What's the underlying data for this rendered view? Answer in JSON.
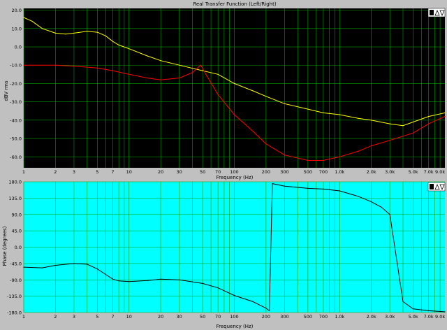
{
  "colors": {
    "top_background": "#000000",
    "bottom_background": "#00ffff",
    "panel_background": "#c0c0c0",
    "grid_top": "#00a000",
    "grid_bottom": "#00a000",
    "left_channel": "#ffff00",
    "right_channel": "#ff0000",
    "phase_trace": "#000000"
  },
  "chart_data": [
    {
      "type": "line",
      "title": "Real Transfer Function (Left/Right)",
      "xlabel": "Frequency (Hz)",
      "ylabel": "dBV rms",
      "x_scale": "log",
      "xlim": [
        1,
        10000
      ],
      "ylim": [
        -66,
        21
      ],
      "grid": true,
      "x_ticks": [
        {
          "value": 1,
          "label": "1"
        },
        {
          "value": 2,
          "label": "2"
        },
        {
          "value": 3,
          "label": "3"
        },
        {
          "value": 5,
          "label": "5"
        },
        {
          "value": 7,
          "label": "7"
        },
        {
          "value": 10,
          "label": "10"
        },
        {
          "value": 20,
          "label": "20"
        },
        {
          "value": 30,
          "label": "30"
        },
        {
          "value": 50,
          "label": "50"
        },
        {
          "value": 70,
          "label": "70"
        },
        {
          "value": 100,
          "label": "100"
        },
        {
          "value": 200,
          "label": "200"
        },
        {
          "value": 300,
          "label": "300"
        },
        {
          "value": 500,
          "label": "500"
        },
        {
          "value": 700,
          "label": "700"
        },
        {
          "value": 1000,
          "label": "1.0k"
        },
        {
          "value": 2000,
          "label": "2.0k"
        },
        {
          "value": 3000,
          "label": "3.0k"
        },
        {
          "value": 5000,
          "label": "5.0k"
        },
        {
          "value": 7000,
          "label": "7.0k"
        },
        {
          "value": 9000,
          "label": "9.0k"
        }
      ],
      "y_ticks": [
        {
          "value": 20,
          "label": "20.0"
        },
        {
          "value": 10,
          "label": "10.0"
        },
        {
          "value": 0,
          "label": "0.0"
        },
        {
          "value": -10,
          "label": "-10.0"
        },
        {
          "value": -20,
          "label": "-20.0"
        },
        {
          "value": -30,
          "label": "-30.0"
        },
        {
          "value": -40,
          "label": "-40.0"
        },
        {
          "value": -50,
          "label": "-50.0"
        },
        {
          "value": -60,
          "label": "-60.0"
        }
      ],
      "series": [
        {
          "color": "#ffff00",
          "x": [
            1,
            1.2,
            1.5,
            2,
            2.5,
            3,
            4,
            5,
            6,
            7,
            8,
            10,
            15,
            20,
            30,
            50,
            70,
            100,
            150,
            200,
            300,
            500,
            700,
            1000,
            1500,
            2000,
            3000,
            4000,
            5000,
            7000,
            10000
          ],
          "y": [
            16,
            14,
            10,
            7.5,
            7,
            7.5,
            8.5,
            8,
            6,
            3,
            1,
            -1,
            -5,
            -7.5,
            -10,
            -13,
            -15,
            -20,
            -24,
            -27,
            -31,
            -34,
            -36,
            -37,
            -39,
            -40,
            -42,
            -43,
            -41,
            -38,
            -36
          ]
        },
        {
          "color": "#ff0000",
          "x": [
            1,
            2,
            3,
            5,
            7,
            10,
            15,
            20,
            30,
            40,
            48,
            55,
            70,
            100,
            150,
            200,
            300,
            500,
            700,
            1000,
            1500,
            2000,
            3000,
            5000,
            7000,
            10000
          ],
          "y": [
            -10,
            -10,
            -10.5,
            -11.5,
            -13,
            -15,
            -17,
            -18,
            -17,
            -14,
            -10,
            -16,
            -26,
            -37,
            -46,
            -53,
            -59,
            -62,
            -62,
            -60,
            -57,
            -54,
            -51,
            -47,
            -42,
            -38
          ]
        }
      ]
    },
    {
      "type": "line",
      "title": "",
      "xlabel": "Frequency (Hz)",
      "ylabel": "Phase (degrees)",
      "x_scale": "log",
      "xlim": [
        1,
        10000
      ],
      "ylim": [
        -180,
        180
      ],
      "grid": true,
      "x_ticks": [
        {
          "value": 1,
          "label": "1"
        },
        {
          "value": 2,
          "label": "2"
        },
        {
          "value": 3,
          "label": "3"
        },
        {
          "value": 5,
          "label": "5"
        },
        {
          "value": 7,
          "label": "7"
        },
        {
          "value": 10,
          "label": "10"
        },
        {
          "value": 20,
          "label": "20"
        },
        {
          "value": 30,
          "label": "30"
        },
        {
          "value": 50,
          "label": "50"
        },
        {
          "value": 70,
          "label": "70"
        },
        {
          "value": 100,
          "label": "100"
        },
        {
          "value": 200,
          "label": "200"
        },
        {
          "value": 300,
          "label": "300"
        },
        {
          "value": 500,
          "label": "500"
        },
        {
          "value": 700,
          "label": "700"
        },
        {
          "value": 1000,
          "label": "1.0k"
        },
        {
          "value": 2000,
          "label": "2.0k"
        },
        {
          "value": 3000,
          "label": "3.0k"
        },
        {
          "value": 5000,
          "label": "5.0k"
        },
        {
          "value": 7000,
          "label": "7.0k"
        },
        {
          "value": 9000,
          "label": "9.0k"
        }
      ],
      "y_ticks": [
        {
          "value": 180,
          "label": "180.0"
        },
        {
          "value": 135,
          "label": "135.0"
        },
        {
          "value": 90,
          "label": "90.0"
        },
        {
          "value": 45,
          "label": "45.0"
        },
        {
          "value": 0,
          "label": "0.0"
        },
        {
          "value": -45,
          "label": "-45.0"
        },
        {
          "value": -90,
          "label": "-90.0"
        },
        {
          "value": -135,
          "label": "-135.0"
        },
        {
          "value": -180,
          "label": "-180.0"
        }
      ],
      "series": [
        {
          "color": "#000000",
          "x": [
            1,
            1.5,
            2,
            3,
            4,
            5,
            6,
            7,
            8,
            10,
            15,
            20,
            30,
            50,
            70,
            100,
            150,
            200,
            215,
            230,
            300,
            500,
            700,
            1000,
            1500,
            2000,
            2500,
            3000,
            4000,
            5000,
            7000,
            10000
          ],
          "y": [
            -55,
            -57,
            -50,
            -45,
            -47,
            -60,
            -75,
            -88,
            -93,
            -95,
            -92,
            -88,
            -90,
            -100,
            -112,
            -133,
            -150,
            -168,
            -175,
            175,
            168,
            162,
            160,
            155,
            140,
            125,
            110,
            90,
            -150,
            -170,
            -175,
            -178
          ]
        }
      ]
    }
  ]
}
